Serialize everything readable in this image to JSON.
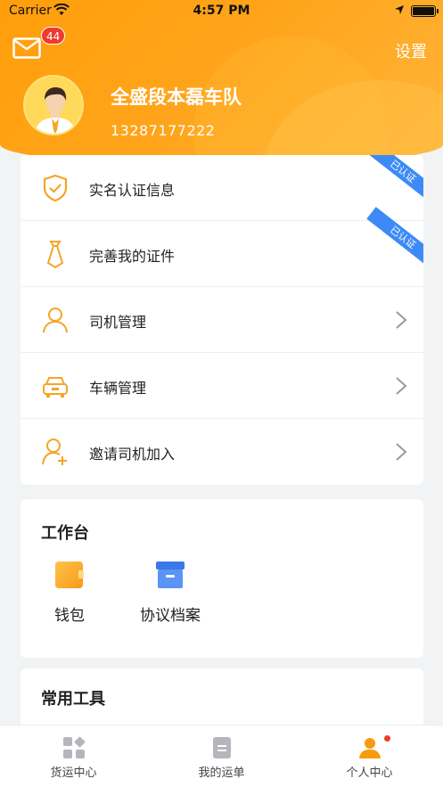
{
  "status_bar": {
    "carrier": "Carrier",
    "time": "4:57 PM"
  },
  "header": {
    "mail_badge": "44",
    "settings_label": "设置",
    "team_name": "全盛段本磊车队",
    "phone": "13287177222"
  },
  "menu": {
    "items": [
      {
        "label": "实名认证信息",
        "icon": "shield-check-icon",
        "ribbon": "已认证"
      },
      {
        "label": "完善我的证件",
        "icon": "tie-icon",
        "ribbon": "已认证"
      },
      {
        "label": "司机管理",
        "icon": "person-icon"
      },
      {
        "label": "车辆管理",
        "icon": "car-icon"
      },
      {
        "label": "邀请司机加入",
        "icon": "person-add-icon"
      }
    ]
  },
  "workbench": {
    "title": "工作台",
    "tools": [
      {
        "label": "钱包",
        "icon": "wallet-icon"
      },
      {
        "label": "协议档案",
        "icon": "archive-box-icon"
      }
    ]
  },
  "common_tools": {
    "title": "常用工具"
  },
  "tabbar": {
    "tabs": [
      {
        "label": "货运中心",
        "icon": "grid-apps-icon"
      },
      {
        "label": "我的运单",
        "icon": "document-icon"
      },
      {
        "label": "个人中心",
        "icon": "user-icon",
        "active": true
      }
    ]
  },
  "colors": {
    "accent": "#ff9e0b",
    "ribbon": "#3d8af7",
    "badge": "#f03a2d",
    "icon_orange": "#f5a524",
    "archive_blue": "#4a86f0"
  }
}
